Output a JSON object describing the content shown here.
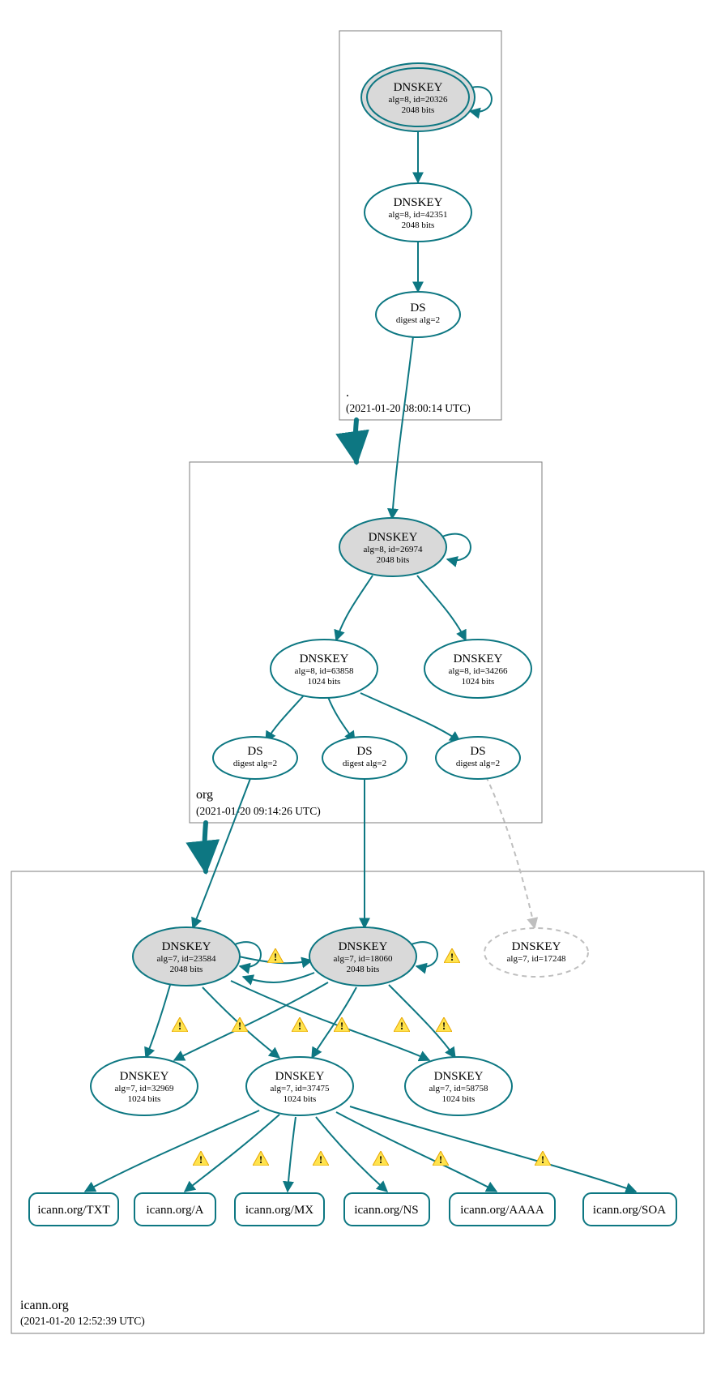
{
  "zones": {
    "root": {
      "label": ".",
      "timestamp": "(2021-01-20 08:00:14 UTC)"
    },
    "org": {
      "label": "org",
      "timestamp": "(2021-01-20 09:14:26 UTC)"
    },
    "icann": {
      "label": "icann.org",
      "timestamp": "(2021-01-20 12:52:39 UTC)"
    }
  },
  "nodes": {
    "rootKskTitle": "DNSKEY",
    "rootKskL1": "alg=8, id=20326",
    "rootKskL2": "2048 bits",
    "rootZskTitle": "DNSKEY",
    "rootZskL1": "alg=8, id=42351",
    "rootZskL2": "2048 bits",
    "rootDsTitle": "DS",
    "rootDsL1": "digest alg=2",
    "orgKskTitle": "DNSKEY",
    "orgKskL1": "alg=8, id=26974",
    "orgKskL2": "2048 bits",
    "orgZsk1Title": "DNSKEY",
    "orgZsk1L1": "alg=8, id=63858",
    "orgZsk1L2": "1024 bits",
    "orgZsk2Title": "DNSKEY",
    "orgZsk2L1": "alg=8, id=34266",
    "orgZsk2L2": "1024 bits",
    "orgDs1Title": "DS",
    "orgDs1L1": "digest alg=2",
    "orgDs2Title": "DS",
    "orgDs2L1": "digest alg=2",
    "orgDs3Title": "DS",
    "orgDs3L1": "digest alg=2",
    "icKsk1Title": "DNSKEY",
    "icKsk1L1": "alg=7, id=23584",
    "icKsk1L2": "2048 bits",
    "icKsk2Title": "DNSKEY",
    "icKsk2L1": "alg=7, id=18060",
    "icKsk2L2": "2048 bits",
    "icKsk3Title": "DNSKEY",
    "icKsk3L1": "alg=7, id=17248",
    "icZsk1Title": "DNSKEY",
    "icZsk1L1": "alg=7, id=32969",
    "icZsk1L2": "1024 bits",
    "icZsk2Title": "DNSKEY",
    "icZsk2L1": "alg=7, id=37475",
    "icZsk2L2": "1024 bits",
    "icZsk3Title": "DNSKEY",
    "icZsk3L1": "alg=7, id=58758",
    "icZsk3L2": "1024 bits",
    "rrTXT": "icann.org/TXT",
    "rrA": "icann.org/A",
    "rrMX": "icann.org/MX",
    "rrNS": "icann.org/NS",
    "rrAAAA": "icann.org/AAAA",
    "rrSOA": "icann.org/SOA"
  }
}
